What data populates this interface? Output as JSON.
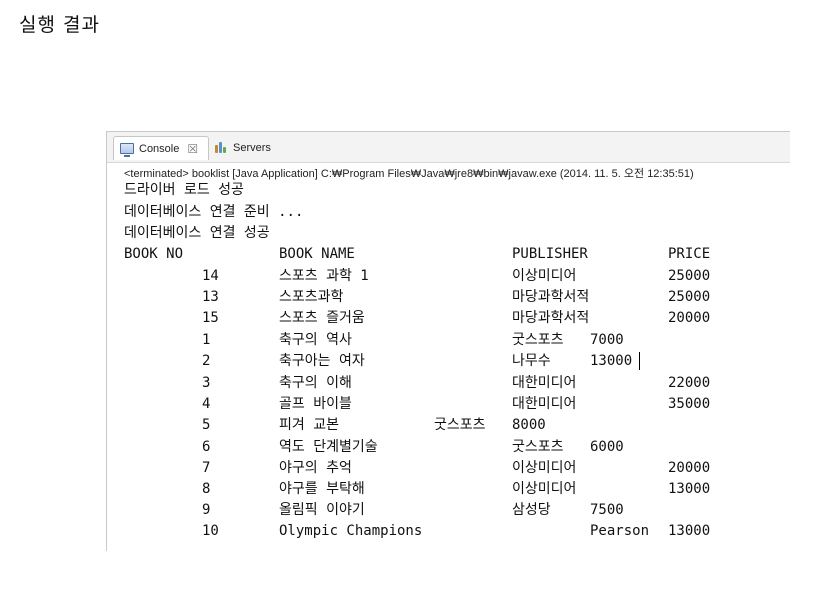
{
  "heading": "실행 결과",
  "tabs": {
    "console_label": "Console",
    "close_glyph": "☒",
    "servers_label": "Servers"
  },
  "status": "<terminated> booklist [Java Application] C:₩Program Files₩Java₩jre8₩bin₩javaw.exe (2014. 11. 5. 오전 12:35:51)",
  "log_lines": [
    "드라이버 로드 성공",
    "데이터베이스 연결 준비 ...",
    "데이터베이스 연결 성공"
  ],
  "columns": {
    "no": "BOOK NO",
    "name": "BOOK NAME",
    "publisher": "PUBLISHER",
    "price": "PRICE"
  },
  "rows": [
    {
      "no": "14",
      "name": "스포츠 과학 1",
      "publisher": "이상미디어",
      "price": "25000"
    },
    {
      "no": "13",
      "name": "스포츠과학",
      "publisher": "마당과학서적",
      "price": "25000"
    },
    {
      "no": "15",
      "name": "스포츠 즐거움",
      "publisher": "마당과학서적",
      "price": "20000"
    },
    {
      "no": "1",
      "name": "축구의 역사",
      "publisher": "굿스포츠",
      "price": "7000"
    },
    {
      "no": "2",
      "name": "축구아는 여자",
      "publisher": "나무수",
      "price": "13000"
    },
    {
      "no": "3",
      "name": "축구의 이해",
      "publisher": "대한미디어",
      "price": "22000"
    },
    {
      "no": "4",
      "name": "골프 바이블",
      "publisher": "대한미디어",
      "price": "35000"
    },
    {
      "no": "5",
      "name": "피겨 교본",
      "publisher": "굿스포츠",
      "price": "8000"
    },
    {
      "no": "6",
      "name": "역도 단계별기술",
      "publisher": "굿스포츠",
      "price": "6000"
    },
    {
      "no": "7",
      "name": "야구의 추억",
      "publisher": "이상미디어",
      "price": "20000"
    },
    {
      "no": "8",
      "name": "야구를 부탁해",
      "publisher": "이상미디어",
      "price": "13000"
    },
    {
      "no": "9",
      "name": "올림픽 이야기",
      "publisher": "삼성당",
      "price": "7500"
    },
    {
      "no": "10",
      "name": "Olympic Champions",
      "publisher": "Pearson",
      "price": "13000"
    }
  ]
}
